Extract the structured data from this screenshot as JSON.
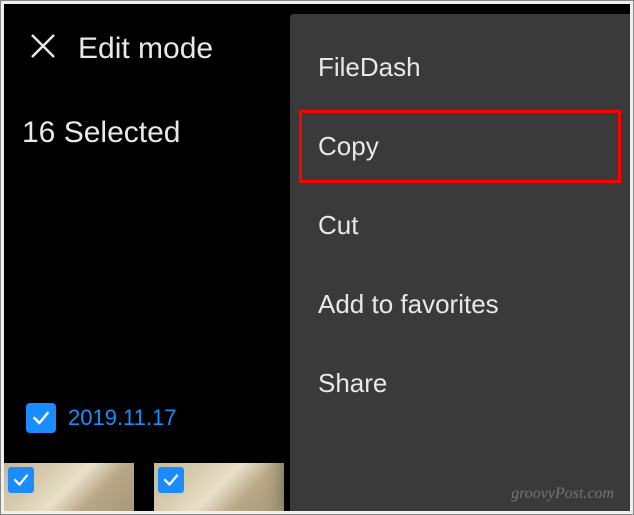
{
  "header": {
    "title": "Edit mode"
  },
  "selection": {
    "count_text": "16 Selected"
  },
  "date_group": {
    "date": "2019.11.17",
    "checked": true
  },
  "thumbnails": [
    {
      "checked": true
    },
    {
      "checked": true
    }
  ],
  "menu": {
    "items": [
      {
        "label": "FileDash",
        "highlighted": false
      },
      {
        "label": "Copy",
        "highlighted": true
      },
      {
        "label": "Cut",
        "highlighted": false
      },
      {
        "label": "Add to favorites",
        "highlighted": false
      },
      {
        "label": "Share",
        "highlighted": false
      }
    ]
  },
  "watermark": "groovyPost.com"
}
